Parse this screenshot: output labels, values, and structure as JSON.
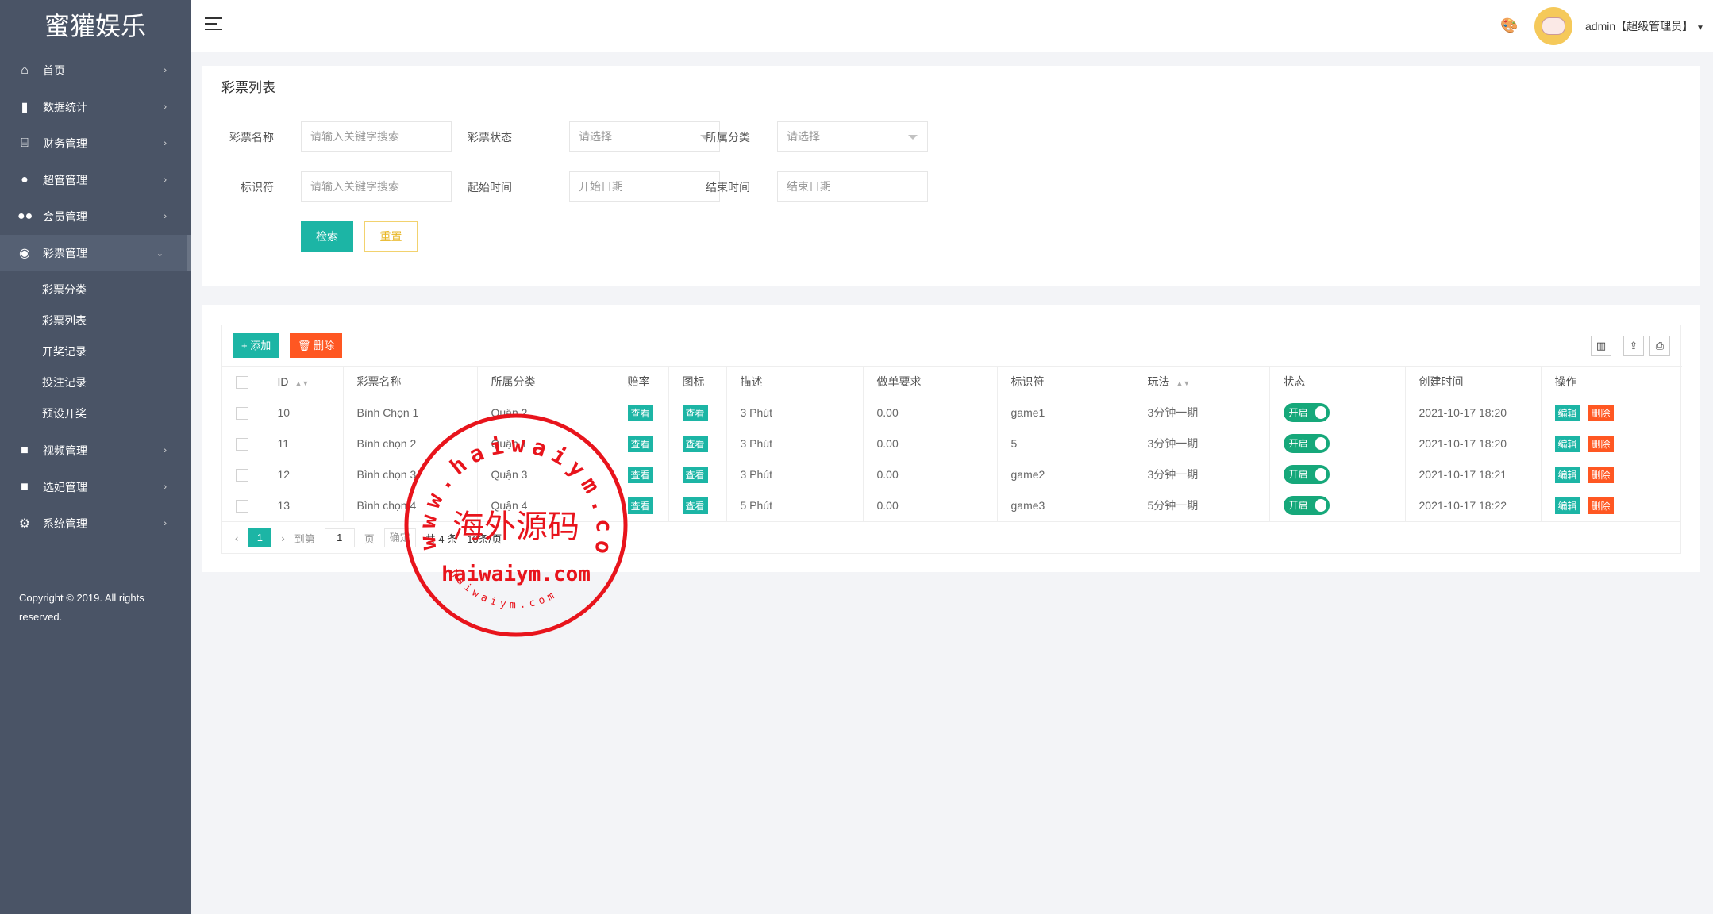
{
  "app": {
    "logo": "蜜獾娱乐",
    "copyright": "Copyright © 2019. All rights reserved."
  },
  "sidebar": {
    "items": [
      {
        "label": "首页",
        "icon": "home-icon",
        "glyph": "⌂"
      },
      {
        "label": "数据统计",
        "icon": "bar-chart-icon",
        "glyph": "▮"
      },
      {
        "label": "财务管理",
        "icon": "bank-icon",
        "glyph": "⌸"
      },
      {
        "label": "超管管理",
        "icon": "user-icon",
        "glyph": "●"
      },
      {
        "label": "会员管理",
        "icon": "users-icon",
        "glyph": "●●"
      },
      {
        "label": "彩票管理",
        "icon": "gamepad-icon",
        "glyph": "◉"
      }
    ],
    "sub_items": [
      "彩票分类",
      "彩票列表",
      "开奖记录",
      "投注记录",
      "预设开奖"
    ],
    "items2": [
      {
        "label": "视频管理",
        "icon": "video-icon",
        "glyph": "■"
      },
      {
        "label": "选妃管理",
        "icon": "video-icon",
        "glyph": "■"
      },
      {
        "label": "系统管理",
        "icon": "gear-icon",
        "glyph": "⚙"
      }
    ]
  },
  "header": {
    "user": "admin【超级管理员】",
    "palette_glyph": "🎨"
  },
  "search": {
    "title": "彩票列表",
    "name_label": "彩票名称",
    "name_placeholder": "请输入关键字搜索",
    "status_label": "彩票状态",
    "status_value": "请选择",
    "category_label": "所属分类",
    "category_value": "请选择",
    "code_label": "标识符",
    "code_placeholder": "请输入关键字搜索",
    "start_label": "起始时间",
    "start_placeholder": "开始日期",
    "end_label": "结束时间",
    "end_placeholder": "结束日期",
    "search_btn": "检索",
    "reset_btn": "重置"
  },
  "table": {
    "add_btn": "+ 添加",
    "delete_btn": "🗑 删除",
    "columns": [
      "ID",
      "彩票名称",
      "所属分类",
      "赔率",
      "图标",
      "描述",
      "做单要求",
      "标识符",
      "玩法",
      "状态",
      "创建时间",
      "操作"
    ],
    "view_label": "查看",
    "switch_label": "开启",
    "edit_label": "编辑",
    "del_label": "删除",
    "rows": [
      {
        "id": "10",
        "name": "Bình Chọn 1",
        "category": "Quận 2",
        "desc": "3 Phút",
        "req": "0.00",
        "code": "game1",
        "play": "3分钟一期",
        "created": "2021-10-17 18:20"
      },
      {
        "id": "11",
        "name": "Bình chọn 2",
        "category": "Quận 1",
        "desc": "3 Phút",
        "req": "0.00",
        "code": "5",
        "play": "3分钟一期",
        "created": "2021-10-17 18:20"
      },
      {
        "id": "12",
        "name": "Bình chọn 3",
        "category": "Quận 3",
        "desc": "3 Phút",
        "req": "0.00",
        "code": "game2",
        "play": "3分钟一期",
        "created": "2021-10-17 18:21"
      },
      {
        "id": "13",
        "name": "Bình chọn 4",
        "category": "Quận 4",
        "desc": "5 Phút",
        "req": "0.00",
        "code": "game3",
        "play": "5分钟一期",
        "created": "2021-10-17 18:22"
      }
    ]
  },
  "pager": {
    "current": "1",
    "goto": "到第",
    "page_input": "1",
    "page_unit": "页",
    "confirm": "确定",
    "total": "共 4 条",
    "per_page": "10条/页"
  },
  "watermark": {
    "center": "海外源码",
    "domain": "haiwaiym.com",
    "arc_top": "www.haiwaiym.com",
    "arc_bottom": "haiwaiym.com",
    "color": "#e8141c"
  },
  "colors": {
    "sidebar": "#4a5466",
    "accent": "#1cb5a5",
    "danger": "#ff5722",
    "switch": "#16a87a"
  }
}
